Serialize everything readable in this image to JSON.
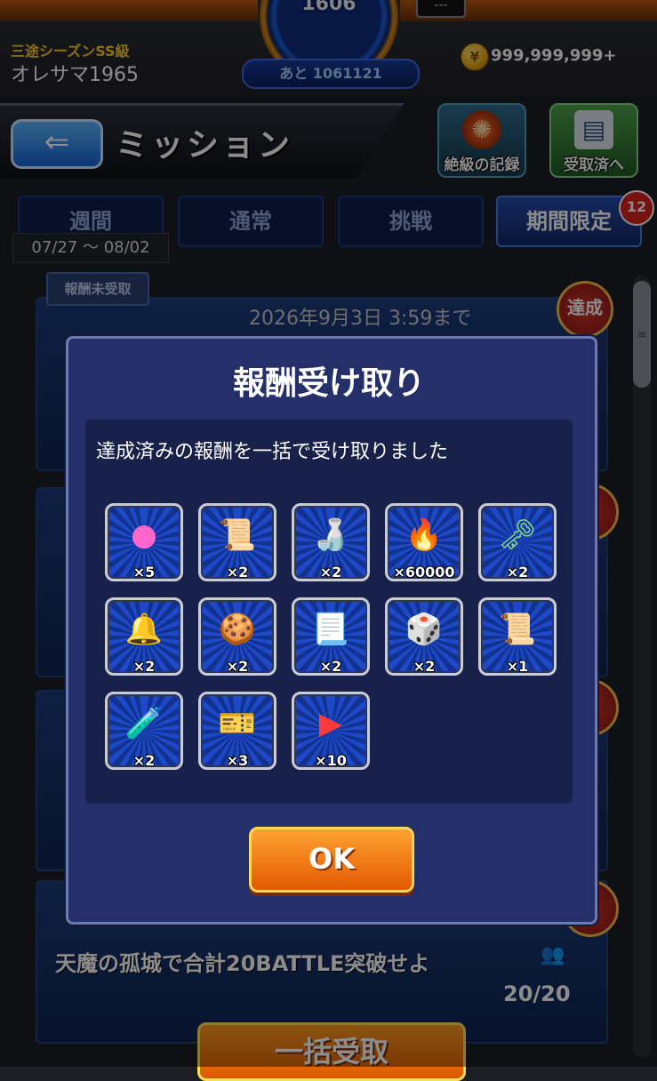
{
  "status": {
    "rank_value": "1606",
    "rank_next_label": "あと 1061121",
    "menu_chip": "---",
    "season_label": "三途シーズンSS級",
    "player_name": "オレサマ1965",
    "coin_glyph": "¥",
    "coin_amount": "999,999,999+"
  },
  "header": {
    "back_glyph": "⇐",
    "title": "ミッション",
    "record_button_label": "絶級の記録",
    "received_button_label": "受取済へ"
  },
  "tabs": [
    {
      "label": "週間",
      "active": false
    },
    {
      "label": "通常",
      "active": false
    },
    {
      "label": "挑戦",
      "active": false
    },
    {
      "label": "期間限定",
      "active": true
    }
  ],
  "tab_badge": "12",
  "weekly_range": "07/27 ～ 08/02",
  "background_list": {
    "tag_label": "報酬未受取",
    "deadline": "2026年9月3日 3:59まで",
    "achieved_label": "達成",
    "last_mission_text": "天魔の孤城で合計20BATTLE突破せよ",
    "last_mission_progress": "20/20",
    "bulk_receive_label": "一括受取"
  },
  "dialog": {
    "title": "報酬受け取り",
    "message": "達成済みの報酬を一括で受け取りました",
    "ok_label": "OK",
    "rewards": [
      {
        "icon": "rainbow-orb-icon",
        "glyph": "●",
        "color": "#ff66cc",
        "qty": "×5"
      },
      {
        "icon": "red-scroll-icon",
        "glyph": "📜",
        "color": "#ff6a2a",
        "qty": "×2"
      },
      {
        "icon": "green-bottle-icon",
        "glyph": "🍶",
        "color": "#7bd84a",
        "qty": "×2"
      },
      {
        "icon": "blue-flame-icon",
        "glyph": "🔥",
        "color": "#9fd4ff",
        "qty": "×60000"
      },
      {
        "icon": "green-key-icon",
        "glyph": "🗝",
        "color": "#8be07a",
        "qty": "×2"
      },
      {
        "icon": "golden-bell-icon",
        "glyph": "🔔",
        "color": "#ffc93a",
        "qty": "×2"
      },
      {
        "icon": "cookie-medal-icon",
        "glyph": "🍪",
        "color": "#e8cf9a",
        "qty": "×2"
      },
      {
        "icon": "red-crest-scroll-icon",
        "glyph": "📃",
        "color": "#ffffff",
        "qty": "×2"
      },
      {
        "icon": "dice-cube-icon",
        "glyph": "🎲",
        "color": "#d48c4a",
        "qty": "×2"
      },
      {
        "icon": "teal-scroll-icon",
        "glyph": "📜",
        "color": "#7fe0d6",
        "qty": "×1"
      },
      {
        "icon": "blue-el-bottle-icon",
        "glyph": "🧪",
        "color": "#7ad8ff",
        "qty": "×2"
      },
      {
        "icon": "ticket-icon",
        "glyph": "🎫",
        "color": "#e2c48a",
        "qty": "×3"
      },
      {
        "icon": "skip-ticket-icon",
        "glyph": "▶",
        "color": "#ff3a3a",
        "qty": "×10"
      }
    ]
  }
}
